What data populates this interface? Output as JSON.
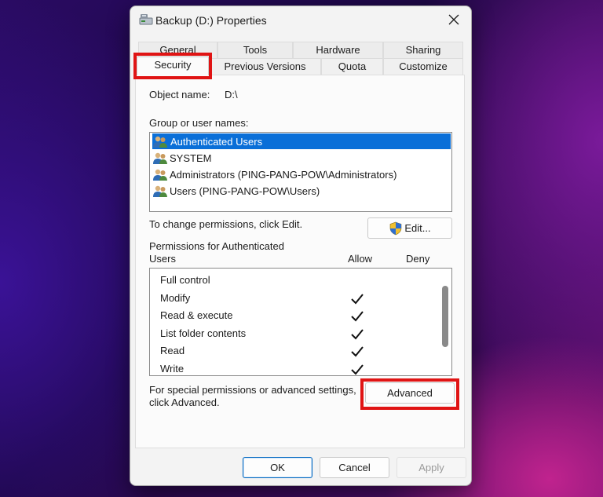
{
  "window": {
    "title": "Backup (D:) Properties"
  },
  "tabs": {
    "row1": [
      {
        "label": "General"
      },
      {
        "label": "Tools"
      },
      {
        "label": "Hardware"
      },
      {
        "label": "Sharing"
      }
    ],
    "row2": [
      {
        "label": "Security"
      },
      {
        "label": "Previous Versions"
      },
      {
        "label": "Quota"
      },
      {
        "label": "Customize"
      }
    ],
    "active": "Security"
  },
  "security": {
    "object_name_label": "Object name:",
    "object_name_value": "D:\\",
    "group_label": "Group or user names:",
    "users": [
      {
        "name": "Authenticated Users",
        "selected": true
      },
      {
        "name": "SYSTEM",
        "selected": false
      },
      {
        "name": "Administrators (PING-PANG-POW\\Administrators)",
        "selected": false
      },
      {
        "name": "Users (PING-PANG-POW\\Users)",
        "selected": false
      }
    ],
    "change_text": "To change permissions, click Edit.",
    "edit_label": "Edit...",
    "perms_label_line1": "Permissions for Authenticated",
    "perms_label_line2": "Users",
    "allow_header": "Allow",
    "deny_header": "Deny",
    "permissions": [
      {
        "name": "Full control",
        "allow": false,
        "deny": false
      },
      {
        "name": "Modify",
        "allow": true,
        "deny": false
      },
      {
        "name": "Read & execute",
        "allow": true,
        "deny": false
      },
      {
        "name": "List folder contents",
        "allow": true,
        "deny": false
      },
      {
        "name": "Read",
        "allow": true,
        "deny": false
      },
      {
        "name": "Write",
        "allow": true,
        "deny": false
      }
    ],
    "special_text_line1": "For special permissions or advanced settings,",
    "special_text_line2": "click Advanced.",
    "advanced_label": "Advanced"
  },
  "footer": {
    "ok_label": "OK",
    "cancel_label": "Cancel",
    "apply_label": "Apply"
  },
  "colors": {
    "highlight": "#e01414",
    "selection": "#0a6fd8",
    "accent": "#0067c0"
  }
}
